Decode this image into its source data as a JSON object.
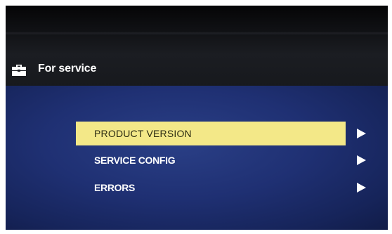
{
  "header": {
    "icon": "toolbox-icon",
    "title": "For service"
  },
  "menu": {
    "items": [
      {
        "label": "PRODUCT VERSION",
        "selected": true,
        "icon": "arrow-right-icon"
      },
      {
        "label": "SERVICE CONFIG",
        "selected": false,
        "icon": "arrow-right-icon"
      },
      {
        "label": "ERRORS",
        "selected": false,
        "icon": "arrow-right-icon"
      }
    ]
  },
  "colors": {
    "highlight": "#f3e888",
    "menu_background": "#1f3073",
    "text": "#ffffff"
  }
}
